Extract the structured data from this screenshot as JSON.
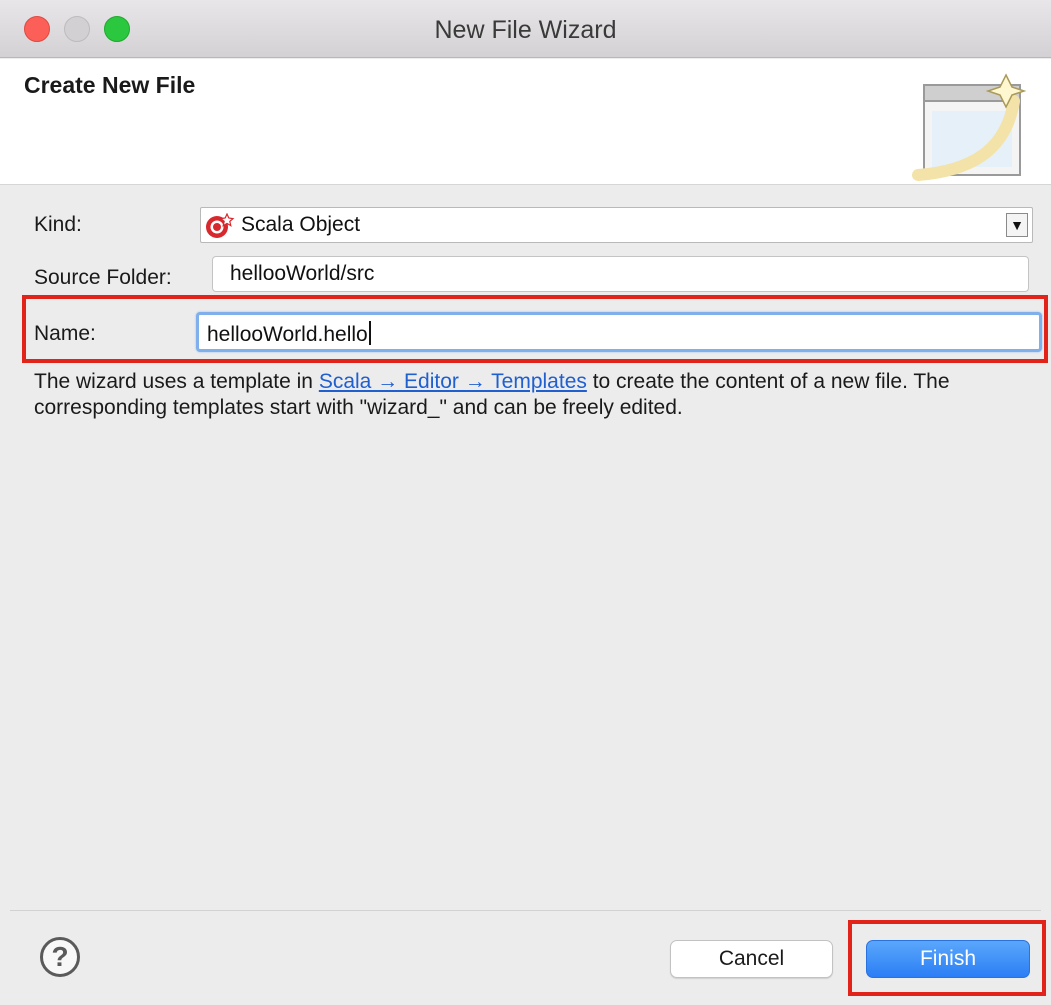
{
  "window": {
    "title": "New File Wizard"
  },
  "banner": {
    "title": "Create New File",
    "art_icon": "new-file-wizard-banner-icon"
  },
  "form": {
    "kind": {
      "label": "Kind:",
      "value": "Scala Object",
      "icon": "scala-object-icon",
      "dropdown_glyph": "▼"
    },
    "source_folder": {
      "label": "Source Folder:",
      "value": "hellooWorld/src"
    },
    "name": {
      "label": "Name:",
      "value": "hellooWorld.hello"
    }
  },
  "info": {
    "text_before": "The wizard uses a template in ",
    "link": "Scala → Editor → Templates",
    "text_after": " to create the content of a new file. The corresponding templates start with \"wizard_\" and can be freely edited."
  },
  "footer": {
    "help_glyph": "?",
    "cancel_label": "Cancel",
    "finish_label": "Finish"
  },
  "colors": {
    "highlight": "#e2231a",
    "finish_button": "#2b7ef5",
    "link": "#1f5fcf",
    "focus_ring": "#7fb0ec"
  }
}
